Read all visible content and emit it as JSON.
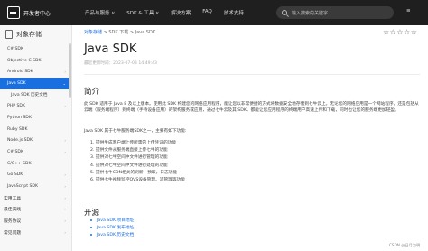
{
  "header": {
    "logo_text": "开发者中心",
    "nav": [
      "产品与服务 ∨",
      "SDK & 工具 ∨",
      "解决方案",
      "FAQ",
      "技术支持"
    ],
    "search_placeholder": "输入搜索的关键字",
    "lang": "≡"
  },
  "sidebar": {
    "title": "对象存储",
    "items": [
      "C# SDK",
      "Objective-C SDK",
      "Android SDK",
      "Java SDK",
      "Java SDK 历史文档",
      "PHP SDK",
      "Python SDK",
      "Ruby SDK",
      "Node.js SDK",
      "C# SDK",
      "C/C++ SDK",
      "Go SDK",
      "JavaScript SDK"
    ],
    "sections": [
      "实用工具",
      "最佳实践",
      "服务协议",
      "常见问题"
    ],
    "active_color": "#1a6fe0"
  },
  "main": {
    "breadcrumb": {
      "link": "对象存储",
      "rest": " > SDK 下载 > Java SDK"
    },
    "stars": "☆☆☆☆☆",
    "title": "Java SDK",
    "updated": "最近更新时间：2023-07-03 14:49:43",
    "intro_heading": "简介",
    "intro_para": "此 SDK 适用于 Java 8 及以上版本。使用此 SDK 构建您的网络应用程序，能让您以非常便捷的方式将数据安全地存储到七牛云上。无论您的网络应用是一个网站程序，还是包括从云端（服务端程序）到终端（手持设备应用）的架构服务或应用，通过七牛云及其 SDK，都能让您应用程序的终端用户高速上传和下载，同时也让您的服务端更加轻盈。",
    "feature_intro": "Java SDK 属于七牛服务端SDK之一，主要有如下功能:",
    "features": [
      "1. 提供生成客户端上传所需的上传凭证的功能",
      "2. 提供文件从服务端直接上传七牛的功能",
      "3. 提供对七牛空间中文件进行管理的功能",
      "4. 提供对七牛空间中文件进行处理的功能",
      "5. 提供七牛CDN相关的刷新，预取，日志功能",
      "6. 提供七牛视频监控QVS设备管理、流管理等功能"
    ],
    "open_heading": "开源",
    "links": [
      "Java SDK 项目地址",
      "Java SDK 发布地址",
      "Java SDK 历史文档"
    ]
  },
  "watermark": "CSDN @日月为明"
}
